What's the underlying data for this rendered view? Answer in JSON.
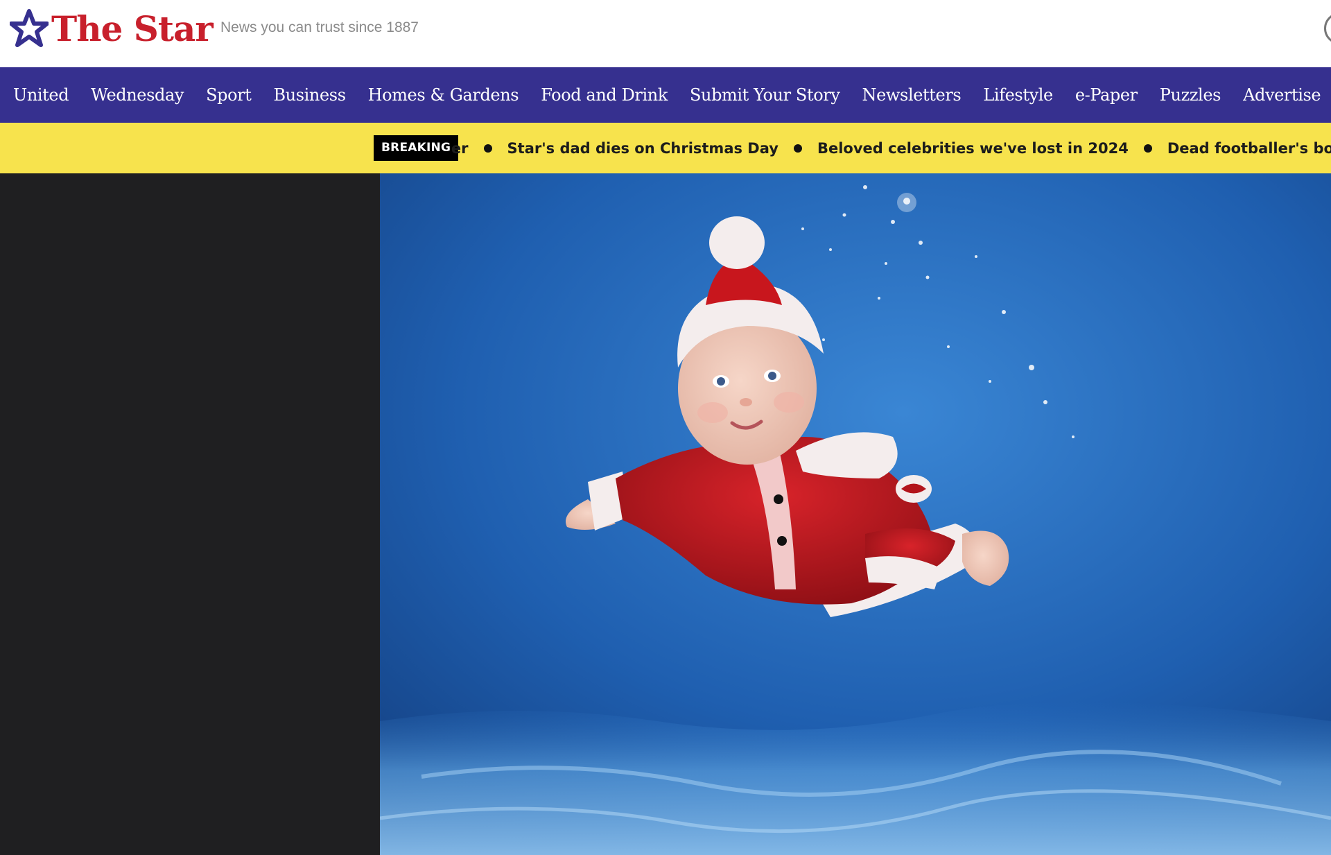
{
  "header": {
    "logo_text": "The Star",
    "tagline": "News you can trust since 1887"
  },
  "nav": {
    "items": [
      {
        "label": "United"
      },
      {
        "label": "Wednesday"
      },
      {
        "label": "Sport"
      },
      {
        "label": "Business"
      },
      {
        "label": "Homes & Gardens"
      },
      {
        "label": "Food and Drink"
      },
      {
        "label": "Submit Your Story"
      },
      {
        "label": "Newsletters"
      },
      {
        "label": "Lifestyle"
      },
      {
        "label": "e-Paper"
      },
      {
        "label": "Puzzles"
      },
      {
        "label": "Advertise"
      }
    ]
  },
  "ticker": {
    "badge": "BREAKING",
    "items": [
      {
        "text": "...battling cancer"
      },
      {
        "text": "Star's dad dies on Christmas Day"
      },
      {
        "text": "Beloved celebrities we've lost in 2024"
      },
      {
        "text": "Dead footballer's body 'can't be..."
      }
    ]
  },
  "hero": {
    "image_subject": "baby in Santa outfit swimming underwater",
    "colors": {
      "water": "#1f5fb0",
      "suit": "#c8161d",
      "trim": "#f4eded"
    }
  },
  "colors": {
    "brand_red": "#c8202c",
    "nav_bg": "#36308f",
    "ticker_bg": "#f7e34d",
    "panel_bg": "#1f1f21"
  }
}
